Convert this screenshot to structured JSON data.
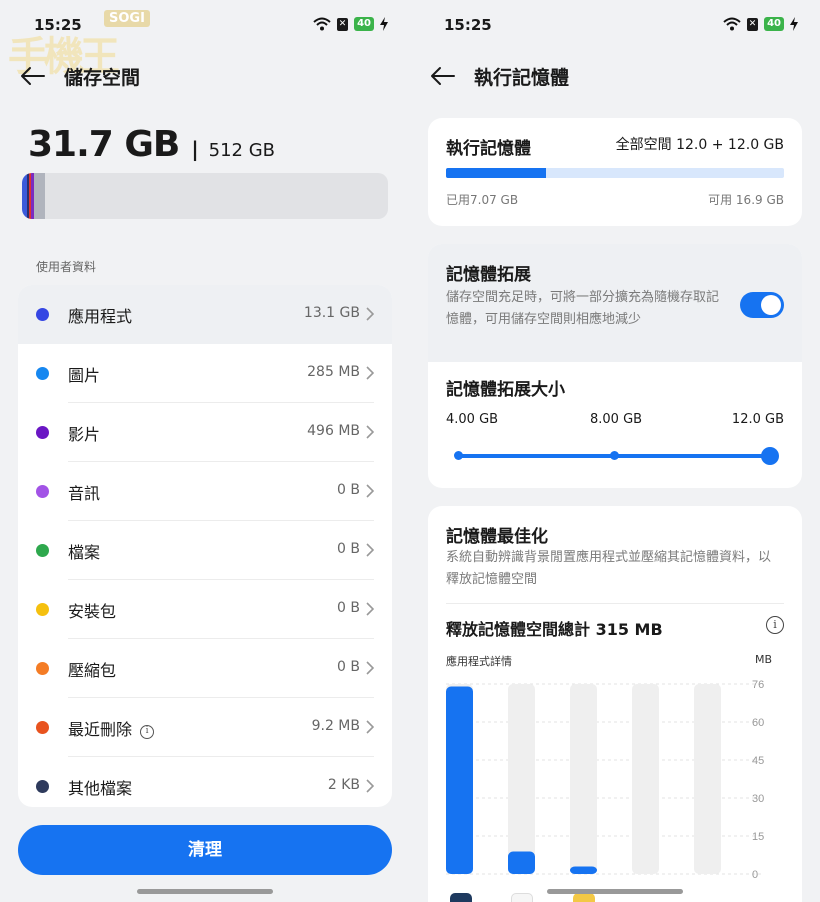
{
  "left": {
    "status": {
      "time": "15:25",
      "battery": "40"
    },
    "watermark": {
      "label": "SOGI",
      "glyphs": "手機王"
    },
    "header": {
      "title": "儲存空間"
    },
    "storage": {
      "used": "31.7 GB",
      "separator": "|",
      "capacity": "512 GB"
    },
    "usage_segments": [
      {
        "color": "#3b5bdb",
        "fraction": 0.013
      },
      {
        "color": "#2a2f6e",
        "fraction": 0.006
      },
      {
        "color": "#e03131",
        "fraction": 0.006
      },
      {
        "color": "#7b2cbf",
        "fraction": 0.008
      },
      {
        "color": "#b0b4bd",
        "fraction": 0.03
      }
    ],
    "section_label": "使用者資料",
    "items": [
      {
        "name": "應用程式",
        "value": "13.1 GB",
        "color": "#3546e3"
      },
      {
        "name": "圖片",
        "value": "285 MB",
        "color": "#1687f0"
      },
      {
        "name": "影片",
        "value": "496 MB",
        "color": "#6a16c4"
      },
      {
        "name": "音訊",
        "value": "0 B",
        "color": "#a253e6"
      },
      {
        "name": "檔案",
        "value": "0 B",
        "color": "#2ea84d"
      },
      {
        "name": "安裝包",
        "value": "0 B",
        "color": "#f5c00f"
      },
      {
        "name": "壓縮包",
        "value": "0 B",
        "color": "#f47c25"
      },
      {
        "name": "最近刪除",
        "value": "9.2 MB",
        "color": "#e8531f"
      },
      {
        "name": "其他檔案",
        "value": "2 KB",
        "color": "#2e3a5c"
      }
    ],
    "clean_button": "清理"
  },
  "right": {
    "status": {
      "time": "15:25",
      "battery": "40"
    },
    "header": {
      "title": "執行記憶體"
    },
    "ram": {
      "title": "執行記憶體",
      "total": "全部空間 12.0 + 12.0 GB",
      "used_label": "已用7.07 GB",
      "available_label": "可用 16.9 GB",
      "used_fraction": 0.295
    },
    "extension": {
      "title": "記憶體拓展",
      "description": "儲存空間充足時，可將一部分擴充為隨機存取記憶體，可用儲存空間則相應地減少",
      "enabled": true,
      "size_title": "記憶體拓展大小",
      "options": [
        "4.00 GB",
        "8.00 GB",
        "12.0 GB"
      ],
      "selected_index": 2
    },
    "optimization": {
      "title": "記憶體最佳化",
      "description": "系統自動辨識背景閒置應用程式並壓縮其記憶體資料，以釋放記憶體空間",
      "freed": "釋放記憶體空間總計 315 MB",
      "chart_data": {
        "type": "bar",
        "xlabel": "應用程式詳情",
        "ylabel": "MB",
        "yticks": [
          "76",
          "60",
          "45",
          "30",
          "15",
          "0"
        ],
        "ylim": [
          0,
          76
        ],
        "values": [
          75,
          9,
          3,
          0,
          0
        ],
        "bar_color": "#1673f1",
        "track_color": "#efefef"
      }
    }
  }
}
